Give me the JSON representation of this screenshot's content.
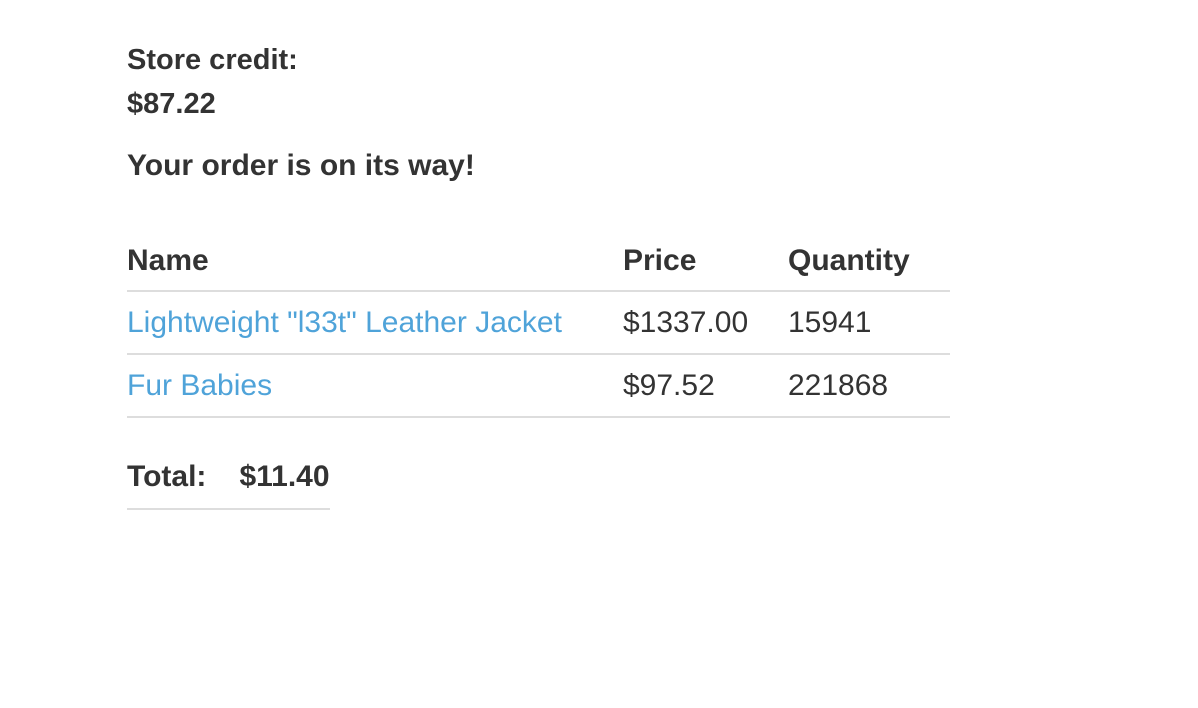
{
  "store_credit": {
    "label": "Store credit:",
    "value": "$87.22"
  },
  "order_status": "Your order is on its way!",
  "table": {
    "headers": {
      "name": "Name",
      "price": "Price",
      "quantity": "Quantity"
    },
    "rows": [
      {
        "name": "Lightweight \"l33t\" Leather Jacket",
        "price": "$1337.00",
        "quantity": "15941"
      },
      {
        "name": "Fur Babies",
        "price": "$97.52",
        "quantity": "221868"
      }
    ]
  },
  "total": {
    "label": "Total:",
    "value": "$11.40"
  },
  "colors": {
    "text": "#333333",
    "link": "#4fa3d9",
    "divider": "#dddddd"
  }
}
